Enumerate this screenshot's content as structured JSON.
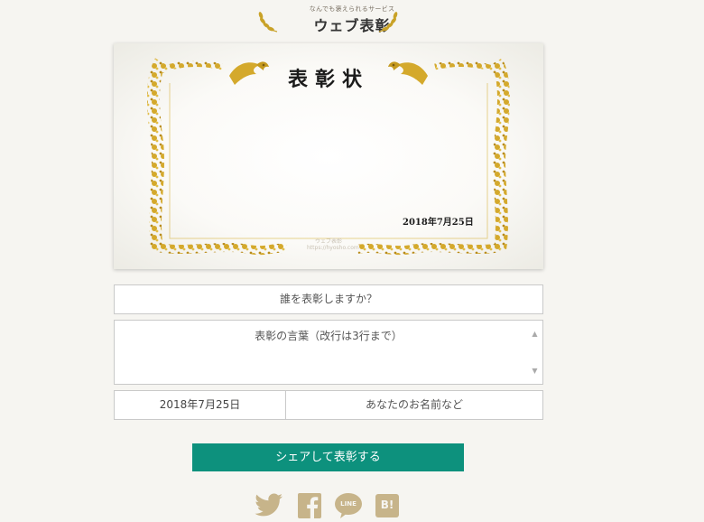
{
  "header": {
    "tagline": "なんでも褒えられるサービス",
    "title": "ウェブ表彰"
  },
  "certificate": {
    "title": "表彰状",
    "date": "2018年7月25日",
    "watermark_line1": "ウェブ表彰",
    "watermark_line2": "https://hyosho.com"
  },
  "form": {
    "recipient_placeholder": "誰を表彰しますか？",
    "message_placeholder": "表彰の言葉（改行は3行まで）",
    "date_value": "2018年7月25日",
    "name_placeholder": "あなたのお名前など"
  },
  "actions": {
    "share_label": "シェアして表彰する"
  },
  "social": {
    "line_label": "LINE",
    "hatena_label": "B!",
    "icons": [
      "twitter-icon",
      "facebook-icon",
      "line-icon",
      "hatena-bookmark-icon"
    ]
  },
  "colors": {
    "background": "#f6f5f1",
    "gold": "#c9a227",
    "accent": "#0d917d",
    "social_icon": "#c7b48a"
  }
}
